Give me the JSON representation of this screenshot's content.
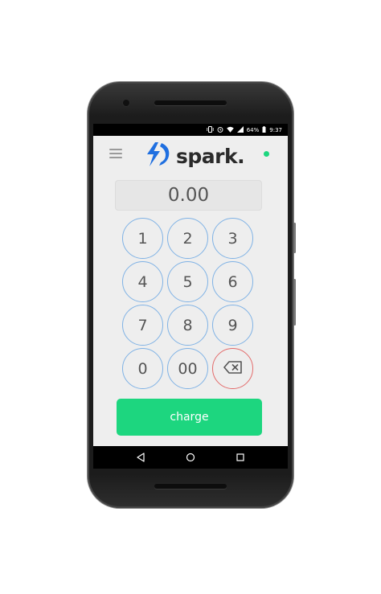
{
  "status_bar": {
    "battery": "64%",
    "time": "9:37",
    "icons": [
      "vibrate-icon",
      "alarm-icon",
      "wifi-icon",
      "cell-signal-icon",
      "battery-icon"
    ]
  },
  "header": {
    "menu_icon": "hamburger-menu-icon",
    "logo_text": "spark.",
    "logo_icon": "lightning-bolt-icon",
    "status_dot_color": "#1dd67f"
  },
  "amount": {
    "value": "0.00"
  },
  "keypad": {
    "keys": [
      "1",
      "2",
      "3",
      "4",
      "5",
      "6",
      "7",
      "8",
      "9",
      "0",
      "00"
    ],
    "delete_icon": "backspace-icon"
  },
  "charge_button": {
    "label": "charge",
    "color": "#1dd67f"
  },
  "nav_bar": {
    "icons": [
      "back-icon",
      "home-icon",
      "recents-icon"
    ]
  },
  "colors": {
    "key_border": "#7fb2e5",
    "delete_border": "#e36b6b",
    "logo_blue": "#1f6fe0"
  }
}
